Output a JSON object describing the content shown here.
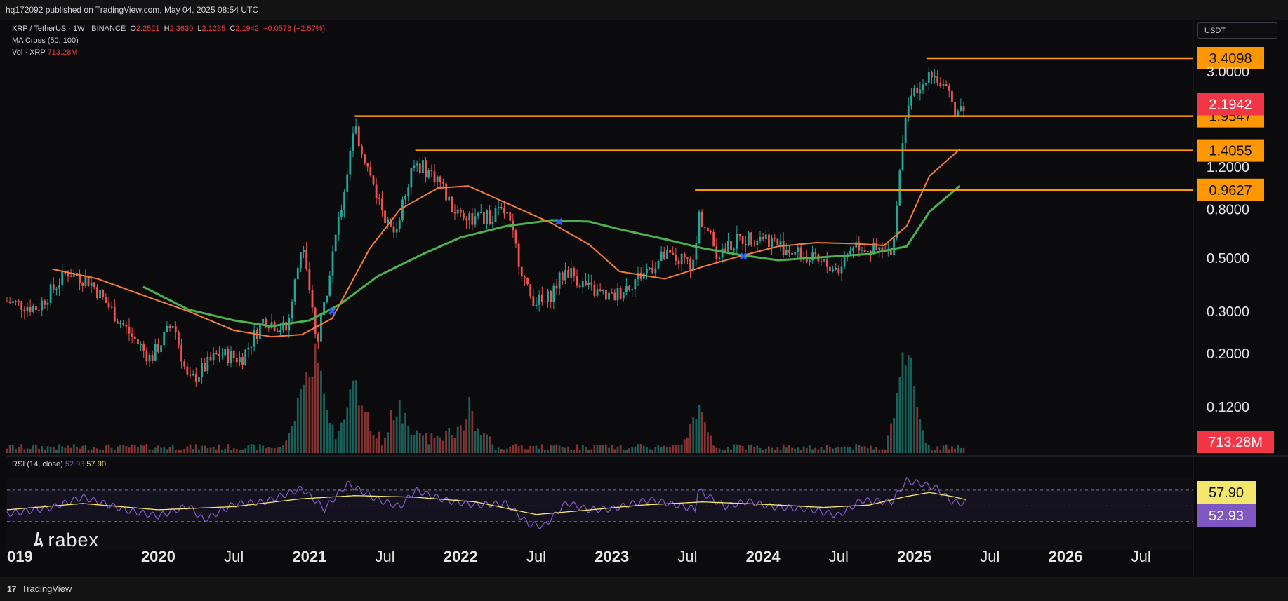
{
  "header": {
    "published": "hq172092 published on TradingView.com, May 04, 2025 08:54 UTC"
  },
  "footer": {
    "brand": "TradingView"
  },
  "symbol": {
    "title": "XRP / TetherUS · 1W · BINANCE",
    "open_label": "O",
    "open": "2.2521",
    "high_label": "H",
    "high": "2.3630",
    "low_label": "L",
    "low": "2.1235",
    "close_label": "C",
    "close": "2.1942",
    "change": "−0.0578 (−2.57%)"
  },
  "indicators": {
    "ma_cross": "MA Cross (50, 100)",
    "volume_label": "Vol · XRP",
    "volume_value": "713.28M",
    "rsi_label": "RSI (14, close)",
    "rsi_value": "52.93",
    "rsi_ma_value": "57.90"
  },
  "currency_selector": "USDT",
  "watermark": "rabex",
  "colors": {
    "background": "#0b0b0d",
    "up": "#26a69a",
    "down": "#ef5350",
    "ma50": "#f57c36",
    "ma100": "#4caf50",
    "level_line": "#ff9800",
    "level_label": "#ff9800",
    "last_price": "#f23645",
    "rsi": "#7e57c2",
    "rsi_ma": "#f5e66c",
    "cross_marker": "#2962ff"
  },
  "chart_data": {
    "type": "candlestick",
    "interval": "1W",
    "scale": "log",
    "y_axis_labels": [
      "3.0000",
      "1.2000",
      "0.8000",
      "0.5000",
      "0.3000",
      "0.2000",
      "0.1200"
    ],
    "x_axis_labels": [
      "019",
      "2020",
      "Jul",
      "2021",
      "Jul",
      "2022",
      "Jul",
      "2023",
      "Jul",
      "2024",
      "Jul",
      "2025",
      "Jul",
      "2026",
      "Jul"
    ],
    "horizontal_levels": [
      {
        "label": "3.4098",
        "value": 3.4098,
        "start": 2025.08
      },
      {
        "label": "1.9547",
        "value": 1.9547,
        "start": 2021.3
      },
      {
        "label": "1.4055",
        "value": 1.4055,
        "start": 2021.7
      },
      {
        "label": "0.9627",
        "value": 0.9627,
        "start": 2023.55
      }
    ],
    "last_price_label": "2.1942",
    "volume_label": "713.28M",
    "rsi_labels": [
      "57.90",
      "52.93"
    ],
    "rsi_bands": [
      70,
      30
    ],
    "ma50": [
      [
        2019.3,
        0.45
      ],
      [
        2019.6,
        0.41
      ],
      [
        2019.9,
        0.35
      ],
      [
        2020.2,
        0.3
      ],
      [
        2020.5,
        0.25
      ],
      [
        2020.75,
        0.235
      ],
      [
        2020.95,
        0.24
      ],
      [
        2021.15,
        0.28
      ],
      [
        2021.4,
        0.55
      ],
      [
        2021.6,
        0.8
      ],
      [
        2021.85,
        0.98
      ],
      [
        2022.05,
        1.0
      ],
      [
        2022.3,
        0.85
      ],
      [
        2022.6,
        0.7
      ],
      [
        2022.85,
        0.57
      ],
      [
        2023.05,
        0.44
      ],
      [
        2023.35,
        0.41
      ],
      [
        2023.6,
        0.46
      ],
      [
        2023.85,
        0.51
      ],
      [
        2024.1,
        0.56
      ],
      [
        2024.35,
        0.58
      ],
      [
        2024.6,
        0.575
      ],
      [
        2024.8,
        0.565
      ],
      [
        2024.95,
        0.68
      ],
      [
        2025.1,
        1.1
      ],
      [
        2025.3,
        1.42
      ]
    ],
    "ma100": [
      [
        2019.9,
        0.38
      ],
      [
        2020.2,
        0.305
      ],
      [
        2020.5,
        0.275
      ],
      [
        2020.75,
        0.26
      ],
      [
        2021.0,
        0.275
      ],
      [
        2021.2,
        0.32
      ],
      [
        2021.45,
        0.42
      ],
      [
        2021.75,
        0.52
      ],
      [
        2022.0,
        0.61
      ],
      [
        2022.3,
        0.68
      ],
      [
        2022.6,
        0.72
      ],
      [
        2022.85,
        0.71
      ],
      [
        2023.05,
        0.66
      ],
      [
        2023.35,
        0.6
      ],
      [
        2023.6,
        0.55
      ],
      [
        2023.85,
        0.515
      ],
      [
        2024.1,
        0.49
      ],
      [
        2024.4,
        0.505
      ],
      [
        2024.7,
        0.52
      ],
      [
        2024.95,
        0.56
      ],
      [
        2025.1,
        0.78
      ],
      [
        2025.3,
        1.0
      ]
    ],
    "crosses": [
      [
        2021.15,
        0.3
      ],
      [
        2022.65,
        0.71
      ],
      [
        2023.87,
        0.51
      ]
    ],
    "price_path": [
      [
        2019.0,
        0.33
      ],
      [
        2019.2,
        0.31
      ],
      [
        2019.4,
        0.44
      ],
      [
        2019.55,
        0.4
      ],
      [
        2019.75,
        0.27
      ],
      [
        2019.95,
        0.19
      ],
      [
        2020.1,
        0.27
      ],
      [
        2020.2,
        0.15
      ],
      [
        2020.4,
        0.2
      ],
      [
        2020.55,
        0.19
      ],
      [
        2020.7,
        0.28
      ],
      [
        2020.85,
        0.25
      ],
      [
        2020.95,
        0.58
      ],
      [
        2021.05,
        0.22
      ],
      [
        2021.15,
        0.5
      ],
      [
        2021.3,
        1.75
      ],
      [
        2021.45,
        0.9
      ],
      [
        2021.55,
        0.62
      ],
      [
        2021.7,
        1.25
      ],
      [
        2021.85,
        1.08
      ],
      [
        2021.95,
        0.8
      ],
      [
        2022.1,
        0.72
      ],
      [
        2022.3,
        0.78
      ],
      [
        2022.45,
        0.35
      ],
      [
        2022.55,
        0.32
      ],
      [
        2022.7,
        0.45
      ],
      [
        2022.85,
        0.37
      ],
      [
        2023.0,
        0.34
      ],
      [
        2023.2,
        0.43
      ],
      [
        2023.35,
        0.51
      ],
      [
        2023.55,
        0.47
      ],
      [
        2023.57,
        0.78
      ],
      [
        2023.7,
        0.52
      ],
      [
        2023.85,
        0.6
      ],
      [
        2024.0,
        0.62
      ],
      [
        2024.15,
        0.55
      ],
      [
        2024.35,
        0.48
      ],
      [
        2024.5,
        0.45
      ],
      [
        2024.6,
        0.58
      ],
      [
        2024.75,
        0.53
      ],
      [
        2024.85,
        0.52
      ],
      [
        2024.9,
        1.1
      ],
      [
        2024.95,
        2.3
      ],
      [
        2025.05,
        2.45
      ],
      [
        2025.1,
        3.1
      ],
      [
        2025.2,
        2.5
      ],
      [
        2025.28,
        2.05
      ],
      [
        2025.34,
        2.19
      ]
    ],
    "rsi_path": [
      [
        2019.0,
        40
      ],
      [
        2019.3,
        48
      ],
      [
        2019.5,
        61
      ],
      [
        2019.8,
        44
      ],
      [
        2020.0,
        37
      ],
      [
        2020.2,
        50
      ],
      [
        2020.3,
        32
      ],
      [
        2020.5,
        52
      ],
      [
        2020.7,
        55
      ],
      [
        2020.95,
        72
      ],
      [
        2021.1,
        46
      ],
      [
        2021.25,
        78
      ],
      [
        2021.45,
        58
      ],
      [
        2021.6,
        49
      ],
      [
        2021.7,
        70
      ],
      [
        2021.9,
        57
      ],
      [
        2022.1,
        51
      ],
      [
        2022.3,
        53
      ],
      [
        2022.45,
        27
      ],
      [
        2022.55,
        24
      ],
      [
        2022.7,
        54
      ],
      [
        2022.85,
        45
      ],
      [
        2023.0,
        46
      ],
      [
        2023.25,
        58
      ],
      [
        2023.55,
        46
      ],
      [
        2023.57,
        70
      ],
      [
        2023.75,
        49
      ],
      [
        2023.9,
        56
      ],
      [
        2024.05,
        49
      ],
      [
        2024.3,
        46
      ],
      [
        2024.5,
        38
      ],
      [
        2024.65,
        57
      ],
      [
        2024.85,
        55
      ],
      [
        2024.95,
        82
      ],
      [
        2025.05,
        78
      ],
      [
        2025.15,
        72
      ],
      [
        2025.25,
        55
      ],
      [
        2025.34,
        52.93
      ]
    ],
    "rsi_ma_path": [
      [
        2019.0,
        45
      ],
      [
        2019.5,
        53
      ],
      [
        2020.0,
        45
      ],
      [
        2020.5,
        49
      ],
      [
        2020.95,
        59
      ],
      [
        2021.3,
        63
      ],
      [
        2021.7,
        61
      ],
      [
        2022.1,
        55
      ],
      [
        2022.5,
        39
      ],
      [
        2022.8,
        44
      ],
      [
        2023.2,
        51
      ],
      [
        2023.6,
        55
      ],
      [
        2024.0,
        52
      ],
      [
        2024.4,
        48
      ],
      [
        2024.7,
        51
      ],
      [
        2024.95,
        62
      ],
      [
        2025.1,
        67
      ],
      [
        2025.25,
        62
      ],
      [
        2025.34,
        57.9
      ]
    ],
    "volume_peaks": [
      [
        2020.95,
        0.7
      ],
      [
        2021.05,
        0.9
      ],
      [
        2021.3,
        0.85
      ],
      [
        2021.6,
        0.45
      ],
      [
        2022.05,
        0.35
      ],
      [
        2023.57,
        0.45
      ],
      [
        2024.93,
        0.85
      ],
      [
        2024.97,
        0.62
      ]
    ]
  }
}
